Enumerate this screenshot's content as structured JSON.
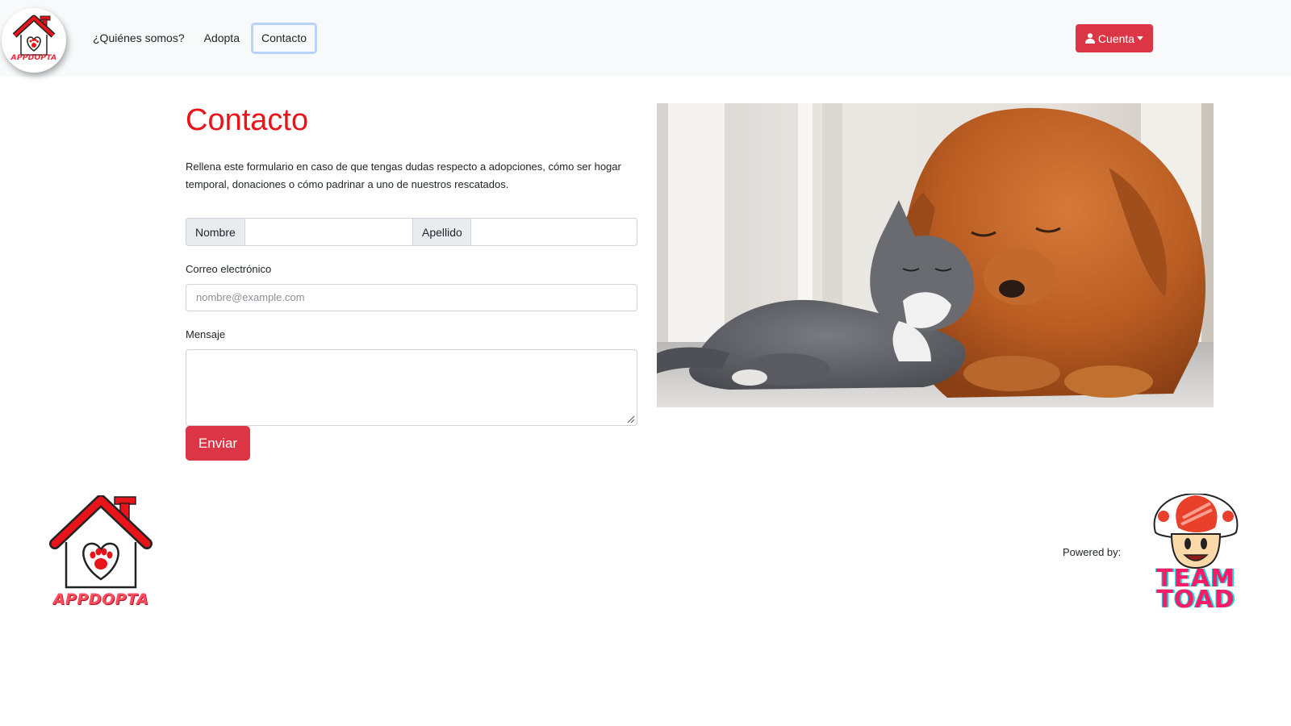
{
  "brand": {
    "logo_text": "APPDOPTA",
    "primary_color": "#dc3545",
    "title_color": "#e8141a"
  },
  "nav": {
    "links": [
      {
        "label": "¿Quiénes somos?"
      },
      {
        "label": "Adopta"
      },
      {
        "label": "Contacto",
        "active": true
      }
    ],
    "account_button": "Cuenta"
  },
  "contact": {
    "title": "Contacto",
    "intro": "Rellena este formulario en caso de que tengas dudas respecto a adopciones, cómo ser hogar temporal, donaciones o cómo padrinar a uno de nuestros rescatados.",
    "first_name_label": "Nombre",
    "first_name_value": "",
    "last_name_label": "Apellido",
    "last_name_value": "",
    "email_label": "Correo electrónico",
    "email_placeholder": "nombre@example.com",
    "email_value": "",
    "message_label": "Mensaje",
    "message_value": "",
    "submit_label": "Enviar"
  },
  "hero_image": {
    "subject": "cat-and-golden-retriever-photo"
  },
  "footer": {
    "logo_text": "APPDOPTA",
    "powered_by": "Powered by:",
    "team_line1": "TEAM",
    "team_line2": "TOAD"
  }
}
